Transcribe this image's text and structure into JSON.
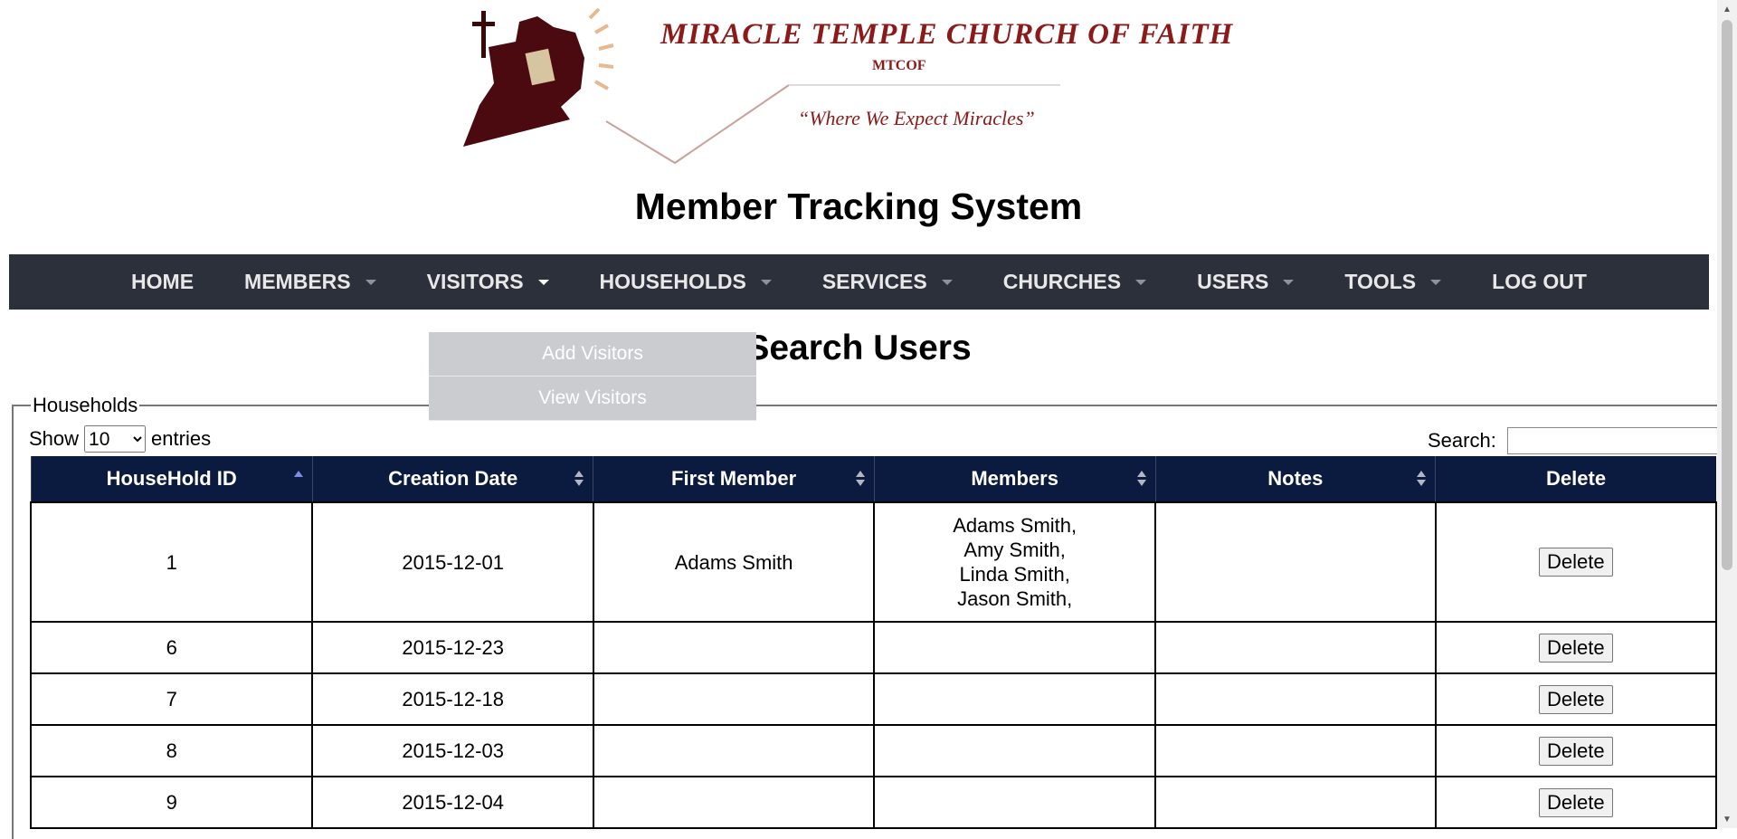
{
  "header": {
    "church_name": "MIRACLE TEMPLE CHURCH OF FAITH",
    "abbreviation": "MTCOF",
    "tagline": "“Where We Expect Miracles”",
    "bible_label": "Holy Bible",
    "brand_color": "#8b1a1a"
  },
  "system_title": "Member Tracking System",
  "nav": {
    "items": [
      {
        "label": "HOME",
        "has_caret": false
      },
      {
        "label": "MEMBERS",
        "has_caret": true
      },
      {
        "label": "VISITORS",
        "has_caret": true,
        "open": true
      },
      {
        "label": "HOUSEHOLDS",
        "has_caret": true
      },
      {
        "label": "SERVICES",
        "has_caret": true
      },
      {
        "label": "CHURCHES",
        "has_caret": true
      },
      {
        "label": "USERS",
        "has_caret": true
      },
      {
        "label": "TOOLS",
        "has_caret": true
      },
      {
        "label": "LOG OUT",
        "has_caret": false
      }
    ],
    "background_color": "#2b303b"
  },
  "visitors_dropdown": {
    "items": [
      "Add Visitors",
      "View Visitors"
    ]
  },
  "page_heading": "Search Users",
  "households": {
    "legend": "Households",
    "show_label": "Show",
    "entries_label": "entries",
    "page_length": "10",
    "search_label": "Search:",
    "search_value": "",
    "columns": [
      "HouseHold ID",
      "Creation Date",
      "First Member",
      "Members",
      "Notes",
      "Delete"
    ],
    "rows": [
      {
        "id": "1",
        "creation_date": "2015-12-01",
        "first_member": "Adams Smith",
        "members": [
          "Adams Smith,",
          "Amy Smith,",
          "Linda Smith,",
          "Jason Smith,"
        ],
        "notes": "",
        "delete_label": "Delete"
      },
      {
        "id": "6",
        "creation_date": "2015-12-23",
        "first_member": "",
        "members": [],
        "notes": "",
        "delete_label": "Delete"
      },
      {
        "id": "7",
        "creation_date": "2015-12-18",
        "first_member": "",
        "members": [],
        "notes": "",
        "delete_label": "Delete"
      },
      {
        "id": "8",
        "creation_date": "2015-12-03",
        "first_member": "",
        "members": [],
        "notes": "",
        "delete_label": "Delete"
      },
      {
        "id": "9",
        "creation_date": "2015-12-04",
        "first_member": "",
        "members": [],
        "notes": "",
        "delete_label": "Delete"
      }
    ],
    "header_color": "#0b1a3f"
  }
}
